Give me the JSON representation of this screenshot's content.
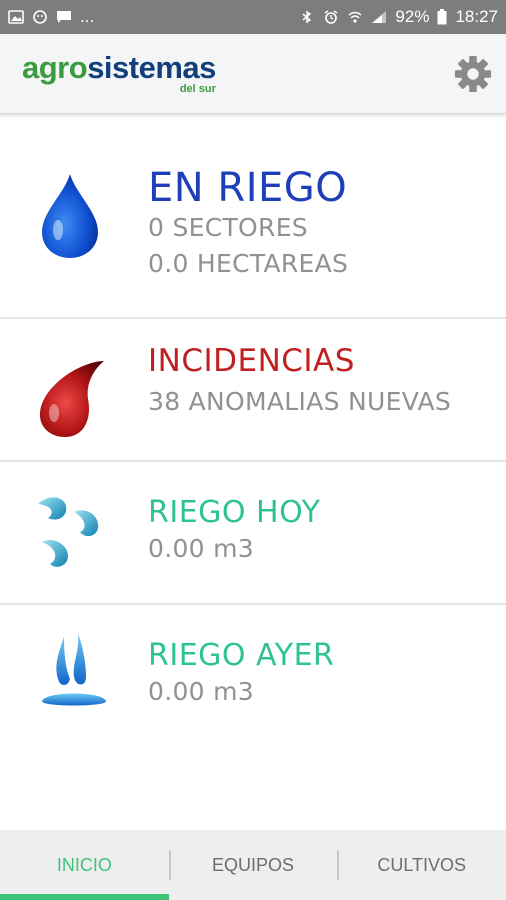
{
  "statusbar": {
    "icons_left": [
      "image-icon",
      "chat-icon",
      "message-icon"
    ],
    "more": "...",
    "icons_right": [
      "bluetooth-icon",
      "alarm-icon",
      "wifi-icon",
      "signal-icon",
      "battery-icon"
    ],
    "battery": "92%",
    "time": "18:27"
  },
  "header": {
    "logo_agro": "agro",
    "logo_sistemas": "sistemas",
    "logo_sub": "del sur",
    "settings_icon": "gear-icon"
  },
  "items": [
    {
      "title": "EN RIEGO",
      "lines": [
        "0 SECTORES",
        "0.0 HECTAREAS"
      ],
      "color": "#1f3fb8",
      "icon": "blue-drop-icon"
    },
    {
      "title": "INCIDENCIAS",
      "lines": [
        "38 ANOMALIAS NUEVAS"
      ],
      "color": "#c0201f",
      "icon": "red-drop-icon"
    },
    {
      "title": "RIEGO HOY",
      "lines": [
        "0.00 m3"
      ],
      "color": "#2ec48f",
      "icon": "water-drops-icon"
    },
    {
      "title": "RIEGO AYER",
      "lines": [
        "0.00 m3"
      ],
      "color": "#2ec48f",
      "icon": "drip-irrigation-icon"
    }
  ],
  "tabs": [
    {
      "label": "INICIO",
      "active": true
    },
    {
      "label": "EQUIPOS",
      "active": false
    },
    {
      "label": "CULTIVOS",
      "active": false
    }
  ],
  "colors": {
    "statusbar": "#7d7d7d",
    "appbar": "#f4f5f6",
    "accent_green": "#3ec47a",
    "logo_blue": "#123f7a",
    "logo_green": "#3a9b3f"
  }
}
